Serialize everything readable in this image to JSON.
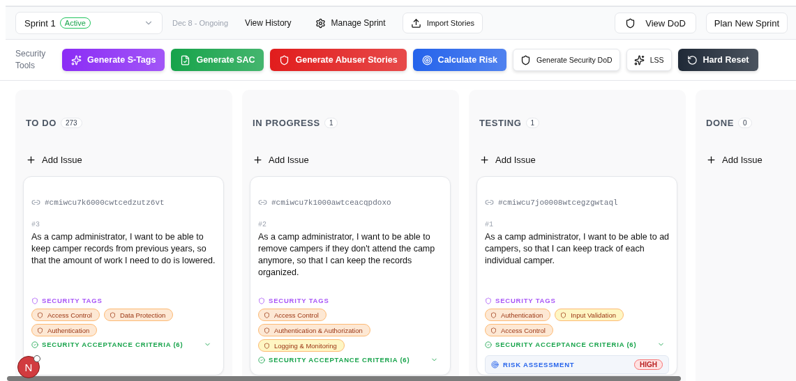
{
  "sprint_bar": {
    "sprint": "Sprint 1",
    "status": "Active",
    "dates": "Dec 8 - Ongoing",
    "actions": [
      {
        "label": "View History",
        "kind": "plain"
      },
      {
        "label": "Manage Sprint",
        "kind": "gear"
      },
      {
        "label": "Import Stories",
        "kind": "upload"
      }
    ],
    "right_actions": [
      {
        "label": "View DoD",
        "kind": "shield"
      },
      {
        "label": "Plan New Sprint",
        "kind": "plain"
      }
    ]
  },
  "security_tools": {
    "label": "Security Tools",
    "buttons": [
      {
        "label": "Generate S-Tags",
        "kind": "sparkle",
        "color": "#8b2cf5"
      },
      {
        "label": "Generate SAC",
        "kind": "doc",
        "color": "#16a34a"
      },
      {
        "label": "Generate Abuser Stories",
        "kind": "shield",
        "color": "#e11d1d"
      },
      {
        "label": "Calculate Risk",
        "kind": "target",
        "color": "#2563eb"
      },
      {
        "label": "Generate Security DoD",
        "kind": "shield-outline",
        "color": "#ffffff"
      },
      {
        "label": "LSS",
        "kind": "sparkle-outline",
        "color": "#ffffff"
      },
      {
        "label": "Hard Reset",
        "kind": "reset",
        "color": "#1f2937"
      }
    ]
  },
  "columns": [
    {
      "title": "TO DO",
      "count": "273",
      "add": "Add Issue",
      "cards": [
        {
          "id": "#cmiwcu7k6000cwtcedzutz6vt",
          "number": "#3",
          "text": "As a camp administrator, I want to be able to keep camper records from previous years, so that the amount of work I need to do is lowered.",
          "tags_title": "SECURITY TAGS",
          "tags": [
            {
              "label": "Access Control",
              "color": "#fde8d4"
            },
            {
              "label": "Data Protection",
              "color": "#fde8d4"
            },
            {
              "label": "Authentication",
              "color": "#fde8d4"
            }
          ],
          "criteria": "SECURITY ACCEPTANCE CRITERIA (6)"
        }
      ]
    },
    {
      "title": "IN PROGRESS",
      "count": "1",
      "add": "Add Issue",
      "cards": [
        {
          "id": "#cmiwcu7k1000awtceacqpdoxo",
          "number": "#2",
          "text": "As a camp administrator, I want to be able to remove campers if they don't attend the camp anymore, so that I can keep the records organized.",
          "tags_title": "SECURITY TAGS",
          "tags": [
            {
              "label": "Access Control",
              "color": "#fde8d4"
            },
            {
              "label": "Authentication & Authorization",
              "color": "#fde8d4"
            },
            {
              "label": "Logging & Monitoring",
              "color": "#fef6c3"
            }
          ],
          "criteria": "SECURITY ACCEPTANCE CRITERIA (6)"
        }
      ]
    },
    {
      "title": "TESTING",
      "count": "1",
      "add": "Add Issue",
      "cards": [
        {
          "id": "#cmiwcu7jo0008wtcegzgwtaql",
          "number": "#1",
          "text": "As a camp administrator, I want to be able to ad campers, so that I can keep track of each individual camper.",
          "tags_title": "SECURITY TAGS",
          "tags": [
            {
              "label": "Authentication",
              "color": "#fde8d4"
            },
            {
              "label": "Input Validation",
              "color": "#fef6c3"
            },
            {
              "label": "Access Control",
              "color": "#fde8d4"
            }
          ],
          "criteria": "SECURITY ACCEPTANCE CRITERIA (6)",
          "risk_title": "RISK ASSESSMENT",
          "risk_level": "HIGH"
        }
      ]
    },
    {
      "title": "DONE",
      "count": "0",
      "add": "Add Issue"
    }
  ],
  "avatar": {
    "initial": "N"
  }
}
